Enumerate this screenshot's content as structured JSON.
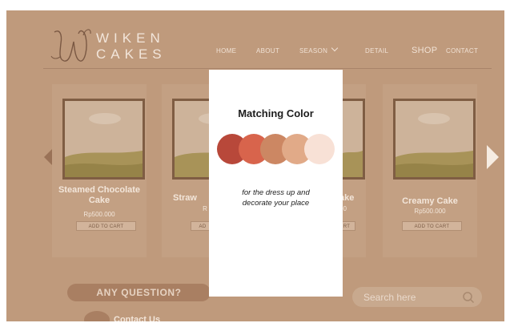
{
  "brand": {
    "line1": "WIKEN",
    "line2": "CAKES"
  },
  "nav": {
    "home": "HOME",
    "about": "ABOUT",
    "season": "SEASON",
    "detail": "DETAIL",
    "shop": "SHOP",
    "contact": "CONTACT"
  },
  "products": [
    {
      "name_line1": "Steamed Chocolate",
      "name_line2": "Cake",
      "price": "Rp500.000",
      "cart": "ADD TO CART"
    },
    {
      "name_line1": "Straw",
      "price": "R",
      "cart": "AD"
    },
    {
      "name_line1": "ake",
      "price": "00",
      "cart": "RT"
    },
    {
      "name_line1": "Creamy Cake",
      "price": "Rp500.000",
      "cart": "ADD TO CART"
    }
  ],
  "question": "ANY QUESTION?",
  "search": {
    "placeholder": "Search here"
  },
  "contact": "Contact Us",
  "modal": {
    "title": "Matching Color",
    "line1": "for the dress up and",
    "line2": "decorate your place",
    "colors": [
      "#b8483a",
      "#d8644c",
      "#cc8763",
      "#e1aa88",
      "#f8e1d6"
    ]
  }
}
